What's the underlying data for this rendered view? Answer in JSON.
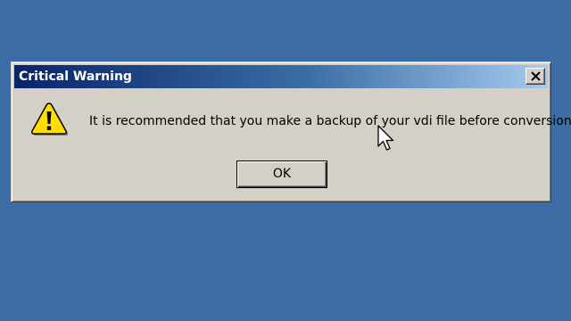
{
  "dialog": {
    "title": "Critical Warning",
    "close_icon": "close-icon",
    "warning_icon": "warning-icon",
    "message": "It is recommended that you make a backup of your vdi file before conversion.",
    "ok_label": "OK"
  },
  "colors": {
    "desktop": "#3c6ea5",
    "titlebar_start": "#0a246a",
    "titlebar_end": "#a6caf0",
    "dialog_face": "#d4d0c8",
    "warning_yellow": "#ffde00"
  }
}
